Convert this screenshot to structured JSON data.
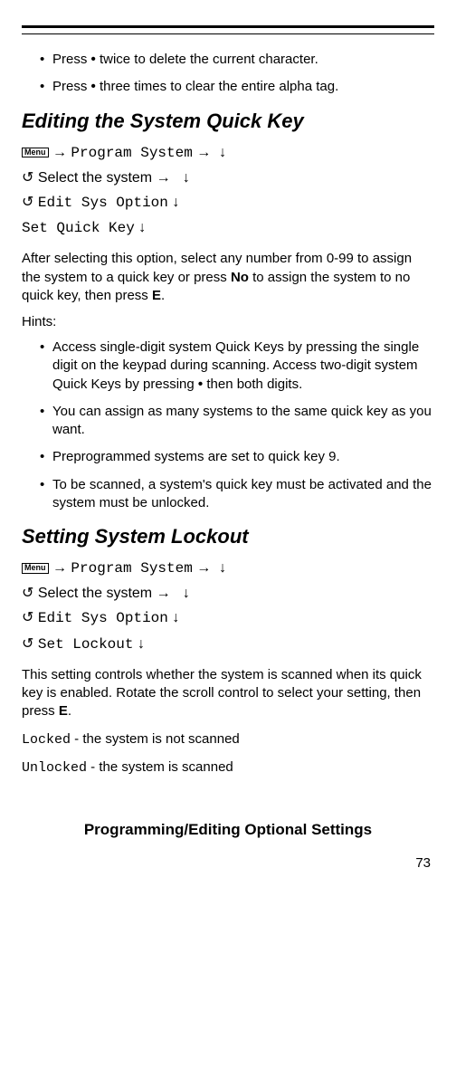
{
  "top_bullets": {
    "b1_pre": "Press ",
    "b1_post": " twice to delete the current character.",
    "b2_pre": "Press ",
    "b2_post": " three times to clear the entire alpha tag."
  },
  "dot": "•",
  "section1": {
    "heading": "Editing the System Quick Key",
    "menu_label": "Menu",
    "arrow_r": "→",
    "arrow_d": "↓",
    "rotate": "↺",
    "nav_program_system": "Program System",
    "nav_select_system": " Select the system ",
    "nav_edit_sys_option": "Edit Sys Option",
    "nav_set_quick_key": "Set Quick Key",
    "body_1a": "After selecting this option, select any number from 0-99 to assign the system to a quick key or press ",
    "body_1_no": "No",
    "body_1b": " to assign the system to no quick key, then press ",
    "body_1_e": "E",
    "body_1c": ".",
    "hints_label": "Hints:",
    "hints": {
      "h1_pre": "Access single-digit system Quick Keys by pressing the single digit on the keypad during scanning. Access two-digit system Quick Keys by pressing ",
      "h1_post": " then both digits.",
      "h2": "You can assign as many systems to the same quick key as you want.",
      "h3": "Preprogrammed systems are set to quick key 9.",
      "h4": "To be scanned, a system's quick key must be activated and the system must be unlocked."
    }
  },
  "section2": {
    "heading": "Setting System Lockout",
    "nav_set_lockout": "Set Lockout",
    "body_2a": "This setting controls whether the system is scanned when its quick key is enabled. Rotate the scroll control to select your setting, then press ",
    "body_2_e": "E",
    "body_2b": ".",
    "locked_code": "Locked",
    "locked_rest": " - the system is not scanned",
    "unlocked_code": "Unlocked",
    "unlocked_rest": " - the system is scanned"
  },
  "footer": {
    "title": "Programming/Editing Optional Settings",
    "page_num": "73"
  }
}
